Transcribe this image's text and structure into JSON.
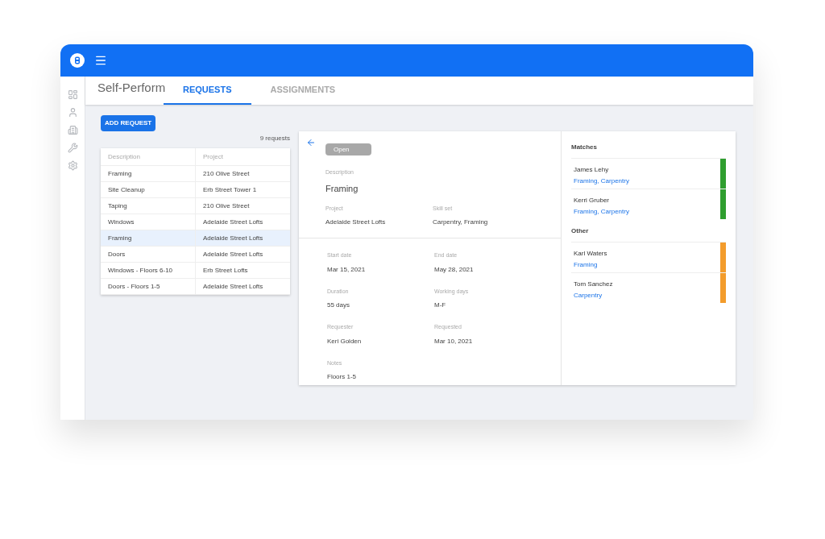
{
  "app_title": "Self-Perform",
  "tabs": [
    {
      "label": "REQUESTS",
      "selected": true
    },
    {
      "label": "ASSIGNMENTS",
      "selected": false
    }
  ],
  "add_button": "ADD REQUEST",
  "count": "9 requests",
  "table": {
    "columns": [
      "Description",
      "Project"
    ],
    "rows": [
      {
        "cells": [
          "Framing",
          "210 Olive Street"
        ],
        "selected": false
      },
      {
        "cells": [
          "Site Cleanup",
          "Erb Street Tower 1"
        ],
        "selected": false
      },
      {
        "cells": [
          "Taping",
          "210 Olive Street"
        ],
        "selected": false
      },
      {
        "cells": [
          "Windows",
          "Adelaide Street Lofts"
        ],
        "selected": false
      },
      {
        "cells": [
          "Framing",
          "Adelaide Street Lofts"
        ],
        "selected": true
      },
      {
        "cells": [
          "Doors",
          "Adelaide Street Lofts"
        ],
        "selected": false
      },
      {
        "cells": [
          "Windows - Floors 6-10",
          "Erb Street Lofts"
        ],
        "selected": false
      },
      {
        "cells": [
          "Doors - Floors 1-5",
          "Adelaide Street Lofts"
        ],
        "selected": false
      }
    ]
  },
  "detail": {
    "status": "Open",
    "description_label": "Description",
    "description": "Framing",
    "top_fields": [
      {
        "label": "Project",
        "value": "Adelaide Street Lofts"
      },
      {
        "label": "Skill set",
        "value": "Carpentry, Framing"
      }
    ],
    "fields": [
      {
        "label": "Start date",
        "value": "Mar 15, 2021"
      },
      {
        "label": "End date",
        "value": "May 28, 2021"
      },
      {
        "label": "Duration",
        "value": "55 days"
      },
      {
        "label": "Working days",
        "value": "M-F"
      },
      {
        "label": "Requester",
        "value": "Keri Golden"
      },
      {
        "label": "Requested",
        "value": "Mar 10, 2021"
      },
      {
        "label": "Notes",
        "value": "Floors 1-5"
      }
    ]
  },
  "groups": [
    {
      "title": "Matches",
      "people": [
        {
          "name": "James Lehy",
          "skills": "Framing, Carpentry",
          "color": "#2f9e2f"
        },
        {
          "name": "Kerri Gruber",
          "skills": "Framing, Carpentry",
          "color": "#2f9e2f"
        }
      ]
    },
    {
      "title": "Other",
      "people": [
        {
          "name": "Karl Waters",
          "skills": "Framing",
          "color": "#f39c2c"
        },
        {
          "name": "Tom Sanchez",
          "skills": "Carpentry",
          "color": "#f39c2c"
        }
      ]
    }
  ]
}
